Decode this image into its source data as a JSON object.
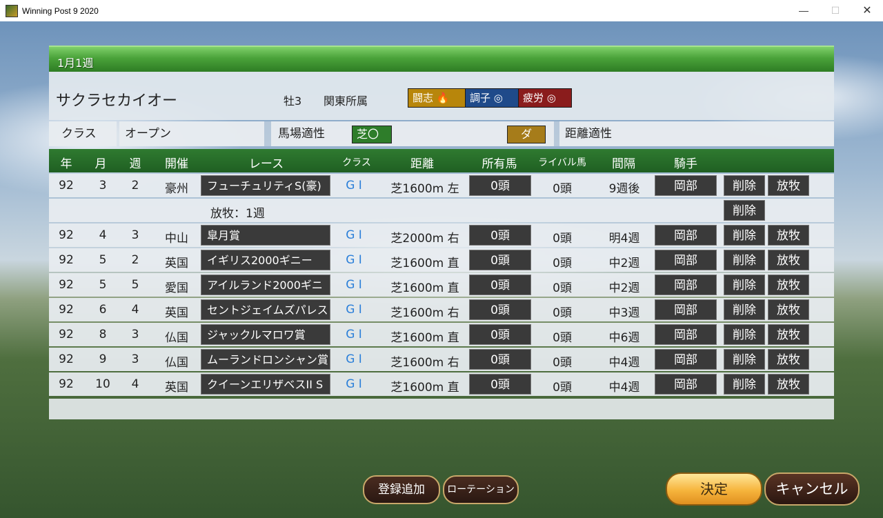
{
  "window": {
    "title": "Winning Post 9 2020",
    "min": "—",
    "max": "☐",
    "close": "✕"
  },
  "week": "1月1週",
  "horse": {
    "name": "サクラセカイオー",
    "sex_age": "牡3",
    "affiliation": "関東所属",
    "badges": {
      "toshi": "闘志 🔥",
      "choshi": "調子 ◎",
      "hirou": "疲労 ◎"
    }
  },
  "info": {
    "class_label": "クラス",
    "class_value": "オープン",
    "surface_label": "馬場適性",
    "turf": "芝〇",
    "dirt": "ダ",
    "distance_label": "距離適性"
  },
  "columns": {
    "year": "年",
    "month": "月",
    "week": "週",
    "venue": "開催",
    "race": "レース",
    "class": "クラス",
    "distance": "距離",
    "owned": "所有馬",
    "rival": "ライバル馬",
    "interval": "間隔",
    "jockey": "騎手"
  },
  "rows": [
    {
      "year": "92",
      "month": "3",
      "week": "2",
      "venue": "豪州",
      "race": "フューチュリティS(豪)",
      "grade": "G I",
      "distance": "芝1600m 左",
      "owned": "0頭",
      "rival": "0頭",
      "interval": "9週後",
      "jockey": "岡部",
      "del": "削除",
      "release": "放牧"
    },
    {
      "year": "92",
      "month": "4",
      "week": "3",
      "venue": "中山",
      "race": "皐月賞",
      "grade": "G I",
      "distance": "芝2000m 右",
      "owned": "0頭",
      "rival": "0頭",
      "interval": "明4週",
      "jockey": "岡部",
      "del": "削除",
      "release": "放牧"
    },
    {
      "year": "92",
      "month": "5",
      "week": "2",
      "venue": "英国",
      "race": "イギリス2000ギニー",
      "grade": "G I",
      "distance": "芝1600m 直",
      "owned": "0頭",
      "rival": "0頭",
      "interval": "中2週",
      "jockey": "岡部",
      "del": "削除",
      "release": "放牧"
    },
    {
      "year": "92",
      "month": "5",
      "week": "5",
      "venue": "愛国",
      "race": "アイルランド2000ギニー",
      "grade": "G I",
      "distance": "芝1600m 直",
      "owned": "0頭",
      "rival": "0頭",
      "interval": "中2週",
      "jockey": "岡部",
      "del": "削除",
      "release": "放牧"
    },
    {
      "year": "92",
      "month": "6",
      "week": "4",
      "venue": "英国",
      "race": "セントジェイムズパレスS",
      "grade": "G I",
      "distance": "芝1600m 右",
      "owned": "0頭",
      "rival": "0頭",
      "interval": "中3週",
      "jockey": "岡部",
      "del": "削除",
      "release": "放牧"
    },
    {
      "year": "92",
      "month": "8",
      "week": "3",
      "venue": "仏国",
      "race": "ジャックルマロワ賞",
      "grade": "G I",
      "distance": "芝1600m 直",
      "owned": "0頭",
      "rival": "0頭",
      "interval": "中6週",
      "jockey": "岡部",
      "del": "削除",
      "release": "放牧"
    },
    {
      "year": "92",
      "month": "9",
      "week": "3",
      "venue": "仏国",
      "race": "ムーランドロンシャン賞",
      "grade": "G I",
      "distance": "芝1600m 右",
      "owned": "0頭",
      "rival": "0頭",
      "interval": "中4週",
      "jockey": "岡部",
      "del": "削除",
      "release": "放牧"
    },
    {
      "year": "92",
      "month": "10",
      "week": "4",
      "venue": "英国",
      "race": "クイーンエリザベスII S",
      "grade": "G I",
      "distance": "芝1600m 直",
      "owned": "0頭",
      "rival": "0頭",
      "interval": "中4週",
      "jockey": "岡部",
      "del": "削除",
      "release": "放牧"
    }
  ],
  "rest_note": {
    "text": "放牧：1週",
    "del": "削除"
  },
  "buttons": {
    "add": "登録追加",
    "rotation": "ローテーション",
    "ok": "決定",
    "cancel": "キャンセル"
  }
}
